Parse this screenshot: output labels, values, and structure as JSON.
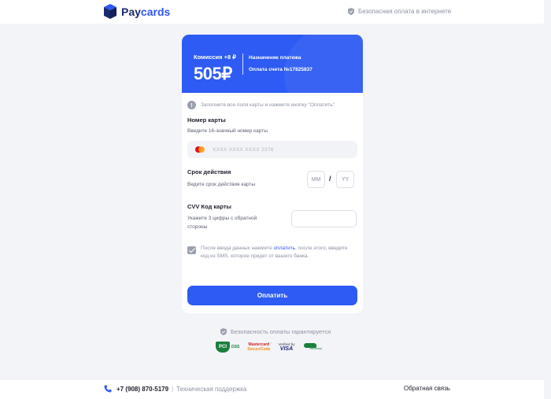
{
  "header": {
    "brand_main": "Pay",
    "brand_accent": "cards",
    "secure_text": "Безопасная оплата в интернете"
  },
  "payment": {
    "commission": "Комиссия +8 ₽",
    "amount": "505₽",
    "purpose_title": "Назначение платежа",
    "purpose_value": "Оплата счета №17825837"
  },
  "form": {
    "notice": "Заполните все поля карты и нажмите кнопку \"Оплатить\"",
    "card_number": {
      "title": "Номер карты",
      "hint": "Введите 16-значный номер карты",
      "placeholder": "XXXX XXXX XXXX 2376"
    },
    "expiry": {
      "title": "Срок действия",
      "hint": "Ведите срок действия карты",
      "month_placeholder": "MM",
      "separator": "/",
      "year_placeholder": "YY"
    },
    "cvv": {
      "title": "CVV Код карты",
      "hint_line1": "Укажите 3 цифры с обратной",
      "hint_line2": "стороны",
      "value": ""
    },
    "sms_note": {
      "before": "После ввода данных нажмите ",
      "link": "оплатить",
      "after": ", после этого, введите код из SMS, которое придет от вашего банка."
    },
    "pay_button": "Оплатить"
  },
  "guarantee": {
    "text": "Безопасность оплаты гарантируется",
    "badges": {
      "pci_mark": "PCI",
      "pci_dss": "DSS",
      "mc_line1": "Mastercard",
      "mc_line2": "SecureCode",
      "visa_line1": "Verified by",
      "visa_name": "VISA",
      "mir_text": "MirAccept"
    }
  },
  "footer": {
    "phone": "+7 (908) 870-5179",
    "separator": "|",
    "support": "Техническая поддержка",
    "feedback": "Обратная связь"
  },
  "colors": {
    "brand_blue": "#2d5bf3",
    "navy": "#1b2a6b",
    "muted_text": "#8d92a3"
  }
}
